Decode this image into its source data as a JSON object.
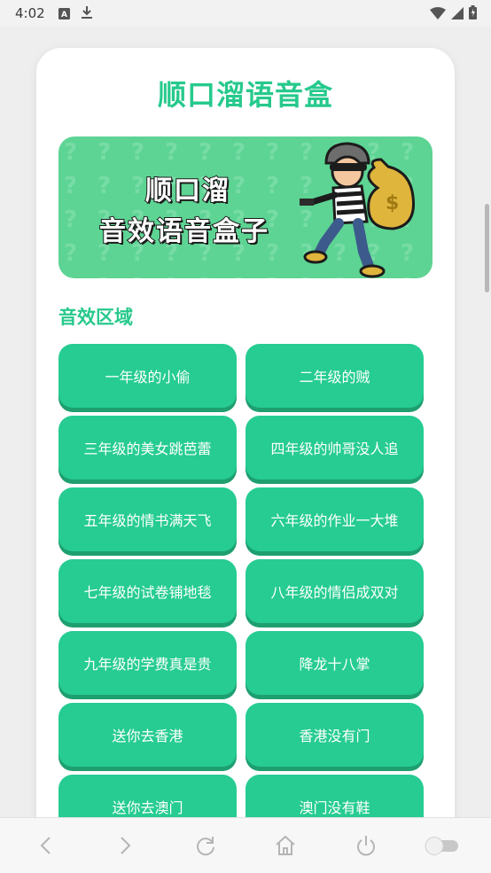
{
  "status_bar": {
    "time": "4:02",
    "left_icons": [
      "a-box-icon",
      "download-icon"
    ],
    "right_icons": [
      "wifi-icon",
      "signal-icon",
      "battery-icon"
    ]
  },
  "app": {
    "title": "顺口溜语音盒"
  },
  "banner": {
    "line1": "顺口溜",
    "line2": "音效语音盒子",
    "background_color": "#5dd493",
    "illustration": "thief-with-money-bag"
  },
  "sound_section": {
    "title": "音效区域",
    "buttons": [
      "一年级的小偷",
      "二年级的贼",
      "三年级的美女跳芭蕾",
      "四年级的帅哥没人追",
      "五年级的情书满天飞",
      "六年级的作业一大堆",
      "七年级的试卷铺地毯",
      "八年级的情侣成双对",
      "九年级的学费真是贵",
      "降龙十八掌",
      "送你去香港",
      "香港没有门",
      "送你去澳门",
      "澳门没有鞋"
    ]
  },
  "browser_bar": {
    "icons": [
      "back-icon",
      "forward-icon",
      "refresh-icon",
      "home-icon",
      "power-icon",
      "toggle-icon"
    ]
  },
  "colors": {
    "accent": "#26c98c",
    "button": "#26cc92",
    "button_shadow": "#1e9f70"
  }
}
